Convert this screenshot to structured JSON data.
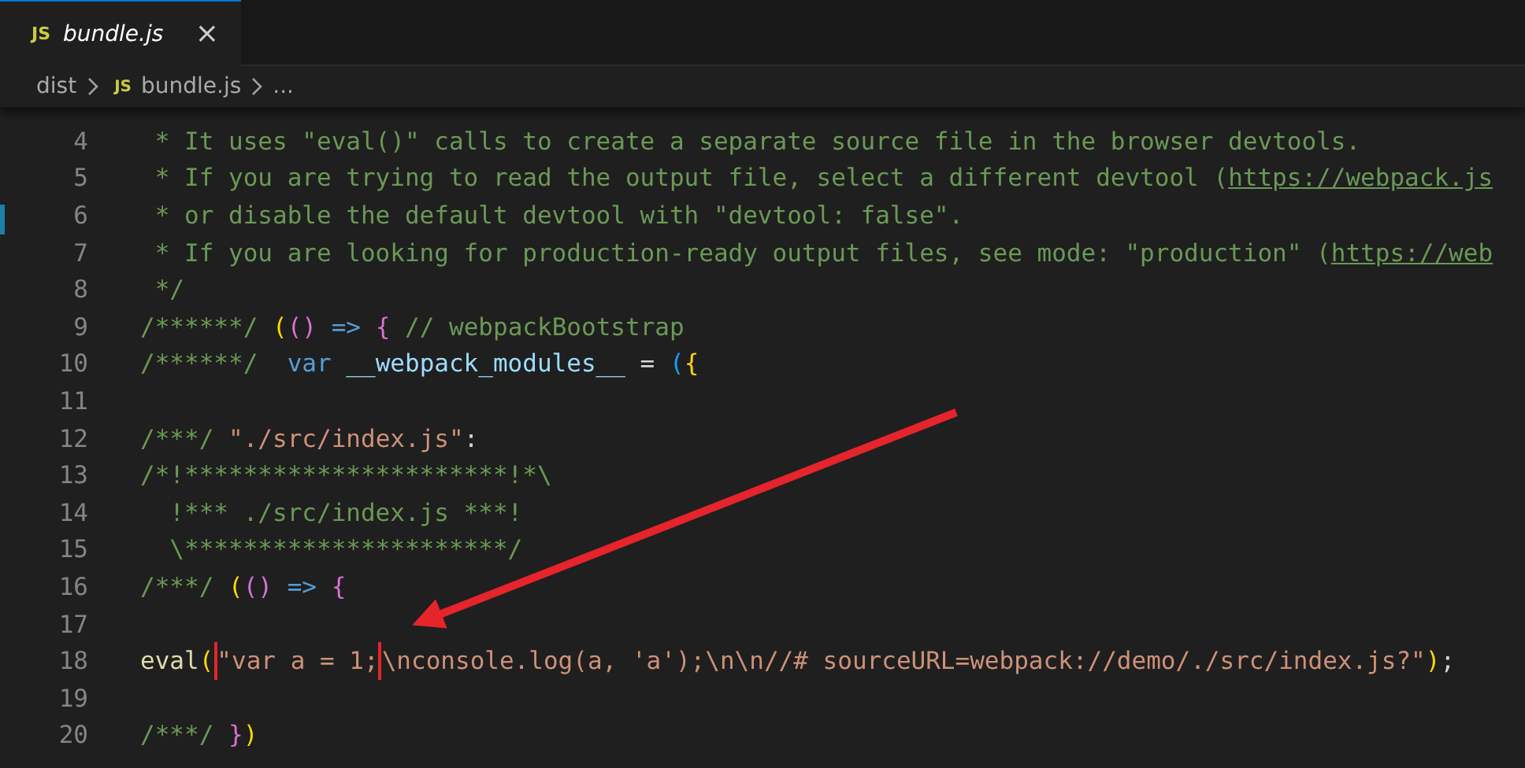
{
  "tab": {
    "icon_text": "JS",
    "label": "bundle.js",
    "selected": true,
    "close": "×"
  },
  "breadcrumb": [
    {
      "label": "dist"
    },
    {
      "label": "bundle.js",
      "icon_text": "JS"
    },
    {
      "label": "..."
    }
  ],
  "lines": [
    {
      "number": "4",
      "changed": false,
      "tokens": [
        {
          "kind": "comment",
          "text": " * It uses \"eval()\" calls to create a separate source file in the browser devtools."
        }
      ]
    },
    {
      "number": "5",
      "changed": false,
      "tokens": [
        {
          "kind": "comment",
          "text": " * If you are trying to read the output file, select a different devtool ("
        },
        {
          "kind": "link",
          "text": "https://webpack.js"
        }
      ]
    },
    {
      "number": "6",
      "changed": true,
      "tokens": [
        {
          "kind": "comment",
          "text": " * or disable the default devtool with \"devtool: false\"."
        }
      ]
    },
    {
      "number": "7",
      "changed": false,
      "tokens": [
        {
          "kind": "comment",
          "text": " * If you are looking for production-ready output files, see mode: \"production\" ("
        },
        {
          "kind": "link",
          "text": "https://web"
        }
      ]
    },
    {
      "number": "8",
      "changed": false,
      "tokens": [
        {
          "kind": "comment",
          "text": " */"
        }
      ]
    },
    {
      "number": "9",
      "changed": false,
      "tokens": [
        {
          "kind": "comment",
          "text": "/******/ "
        },
        {
          "kind": "bracket1",
          "text": "("
        },
        {
          "kind": "bracket2",
          "text": "()"
        },
        {
          "kind": "keyword",
          "text": " => "
        },
        {
          "kind": "bracket2",
          "text": "{"
        },
        {
          "kind": "comment",
          "text": " // webpackBootstrap"
        }
      ]
    },
    {
      "number": "10",
      "changed": false,
      "tokens": [
        {
          "kind": "comment",
          "text": "/******/  "
        },
        {
          "kind": "keyword",
          "text": "var "
        },
        {
          "kind": "variable",
          "text": "__webpack_modules__"
        },
        {
          "kind": "plain",
          "text": " = "
        },
        {
          "kind": "bracket3",
          "text": "("
        },
        {
          "kind": "bracket1",
          "text": "{"
        }
      ]
    },
    {
      "number": "11",
      "changed": false
    },
    {
      "number": "12",
      "changed": false,
      "tokens": [
        {
          "kind": "comment",
          "text": "/***/ "
        },
        {
          "kind": "string",
          "text": "\"./src/index.js\""
        },
        {
          "kind": "plain",
          "text": ":"
        }
      ]
    },
    {
      "number": "13",
      "changed": false,
      "tokens": [
        {
          "kind": "comment",
          "text": "/*!**********************!*\\"
        }
      ]
    },
    {
      "number": "14",
      "changed": false,
      "tokens": [
        {
          "kind": "comment",
          "text": "  !*** ./src/index.js ***!"
        }
      ]
    },
    {
      "number": "15",
      "changed": false,
      "tokens": [
        {
          "kind": "comment",
          "text": "  \\**********************/"
        }
      ]
    },
    {
      "number": "16",
      "changed": false,
      "tokens": [
        {
          "kind": "comment",
          "text": "/***/ "
        },
        {
          "kind": "bracket1",
          "text": "("
        },
        {
          "kind": "bracket2",
          "text": "()"
        },
        {
          "kind": "keyword",
          "text": " => "
        },
        {
          "kind": "bracket2",
          "text": "{"
        }
      ]
    },
    {
      "number": "17",
      "changed": false
    },
    {
      "number": "18",
      "changed": false,
      "tokens": [
        {
          "kind": "function",
          "text": "eval"
        },
        {
          "kind": "bracket1",
          "text": "("
        },
        {
          "kind": "boxed",
          "text": "\"var a = 1;"
        },
        {
          "kind": "string",
          "text": "\\nconsole.log(a, 'a');\\n\\n//# sourceURL=webpack://demo/./src/index.js?\""
        },
        {
          "kind": "bracket1",
          "text": ")"
        },
        {
          "kind": "plain",
          "text": ";"
        }
      ]
    },
    {
      "number": "19",
      "changed": false
    },
    {
      "number": "20",
      "changed": false,
      "tokens": [
        {
          "kind": "comment",
          "text": "/***/ "
        },
        {
          "kind": "bracket2",
          "text": "}"
        },
        {
          "kind": "bracket1",
          "text": ")"
        }
      ]
    }
  ]
}
